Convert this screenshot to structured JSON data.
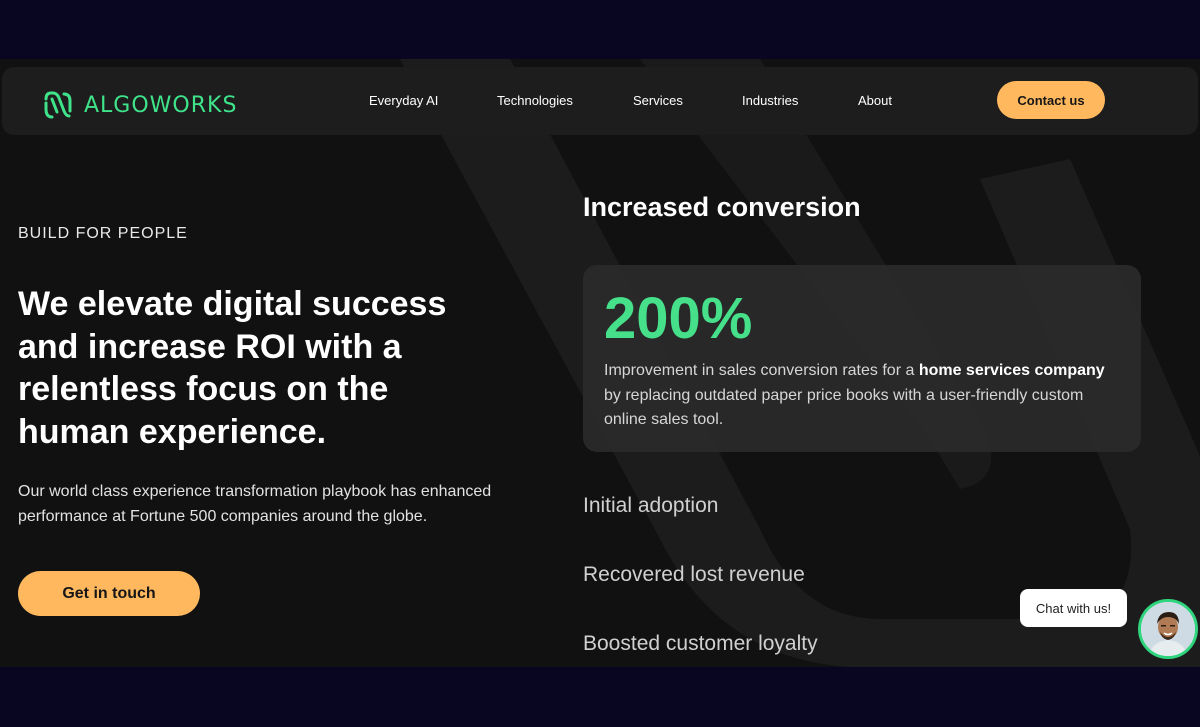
{
  "brand": {
    "name": "ALGOWORKS",
    "accent": "#3fe38a",
    "cta_color": "#ffb85e"
  },
  "nav": {
    "items": [
      {
        "label": "Everyday AI"
      },
      {
        "label": "Technologies"
      },
      {
        "label": "Services"
      },
      {
        "label": "Industries"
      },
      {
        "label": "About"
      }
    ],
    "contact_label": "Contact us"
  },
  "hero": {
    "eyebrow": "BUILD FOR PEOPLE",
    "headline": "We elevate digital success and increase ROI with a relentless focus on the human experience.",
    "subtext": "Our world class experience transformation playbook has enhanced performance at Fortune 500 companies around the globe.",
    "cta_label": "Get in touch"
  },
  "results": {
    "active_title": "Increased conversion",
    "stat": {
      "value": "200%",
      "desc_before": "Improvement in sales conversion rates for a ",
      "desc_bold": "home services company",
      "desc_after": " by replacing outdated paper price books with a user-friendly custom online sales tool."
    },
    "items": [
      {
        "label": "Initial adoption"
      },
      {
        "label": "Recovered lost revenue"
      },
      {
        "label": "Boosted customer loyalty"
      }
    ]
  },
  "chat": {
    "label": "Chat with us!",
    "avatar_icon": "person-avatar-icon"
  }
}
